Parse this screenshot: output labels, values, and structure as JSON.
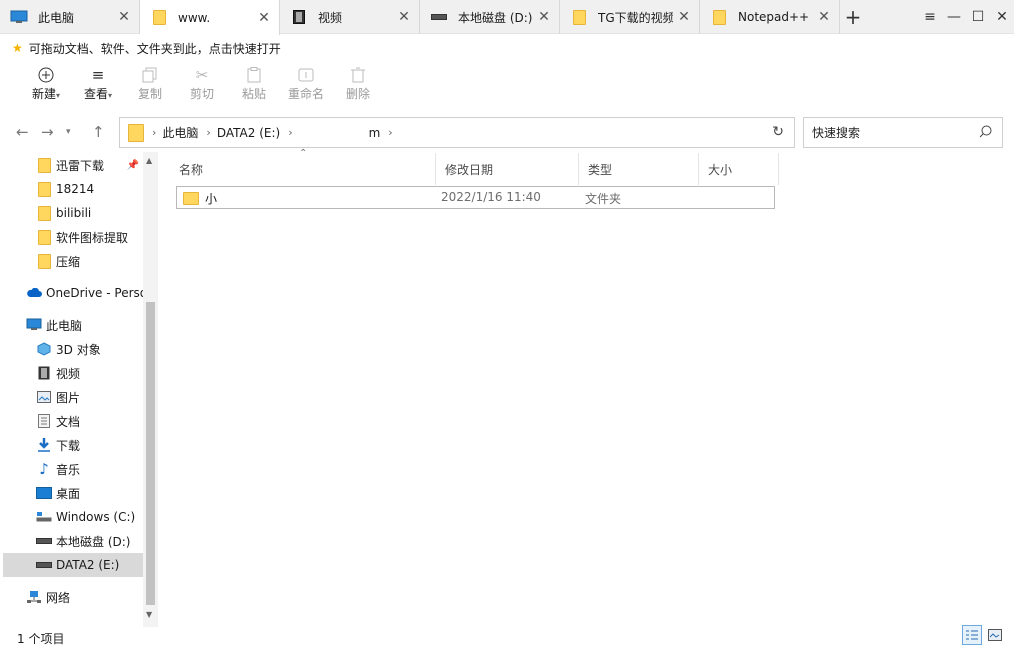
{
  "tabs": [
    {
      "label": "此电脑",
      "icon": "computer-icon"
    },
    {
      "label": "www.",
      "icon": "folder-icon",
      "active": true
    },
    {
      "label": "视频",
      "icon": "video-folder-icon"
    },
    {
      "label": "本地磁盘 (D:)",
      "icon": "drive-icon"
    },
    {
      "label": "TG下载的视频",
      "icon": "folder-icon"
    },
    {
      "label": "Notepad++",
      "icon": "folder-icon"
    }
  ],
  "favorites": {
    "hint": "可拖动文档、软件、文件夹到此，点击快速打开"
  },
  "ribbon": {
    "new_label": "新建",
    "view_label": "查看",
    "copy_label": "复制",
    "cut_label": "剪切",
    "paste_label": "粘贴",
    "rename_label": "重命名",
    "delete_label": "删除"
  },
  "address": {
    "crumbs": [
      "此电脑",
      "DATA2 (E:)",
      "m"
    ]
  },
  "search": {
    "placeholder": "快速搜索"
  },
  "nav": {
    "quick": [
      "迅雷下载",
      "18214",
      "bilibili",
      "软件图标提取",
      "压缩"
    ],
    "onedrive": "OneDrive - Perso",
    "thispc": "此电脑",
    "pc_items": [
      "3D 对象",
      "视频",
      "图片",
      "文档",
      "下载",
      "音乐",
      "桌面",
      "Windows (C:)",
      "本地磁盘 (D:)",
      "DATA2 (E:)"
    ],
    "network": "网络"
  },
  "columns": {
    "name": "名称",
    "date": "修改日期",
    "type": "类型",
    "size": "大小"
  },
  "files": [
    {
      "name": "小",
      "date": "2022/1/16 11:40",
      "type": "文件夹",
      "size": ""
    }
  ],
  "status": {
    "count": "1 个项目"
  },
  "colors": {
    "folder": "#ffd65e",
    "selected_nav": "#d9d9d9",
    "accent": "#0078d4"
  }
}
